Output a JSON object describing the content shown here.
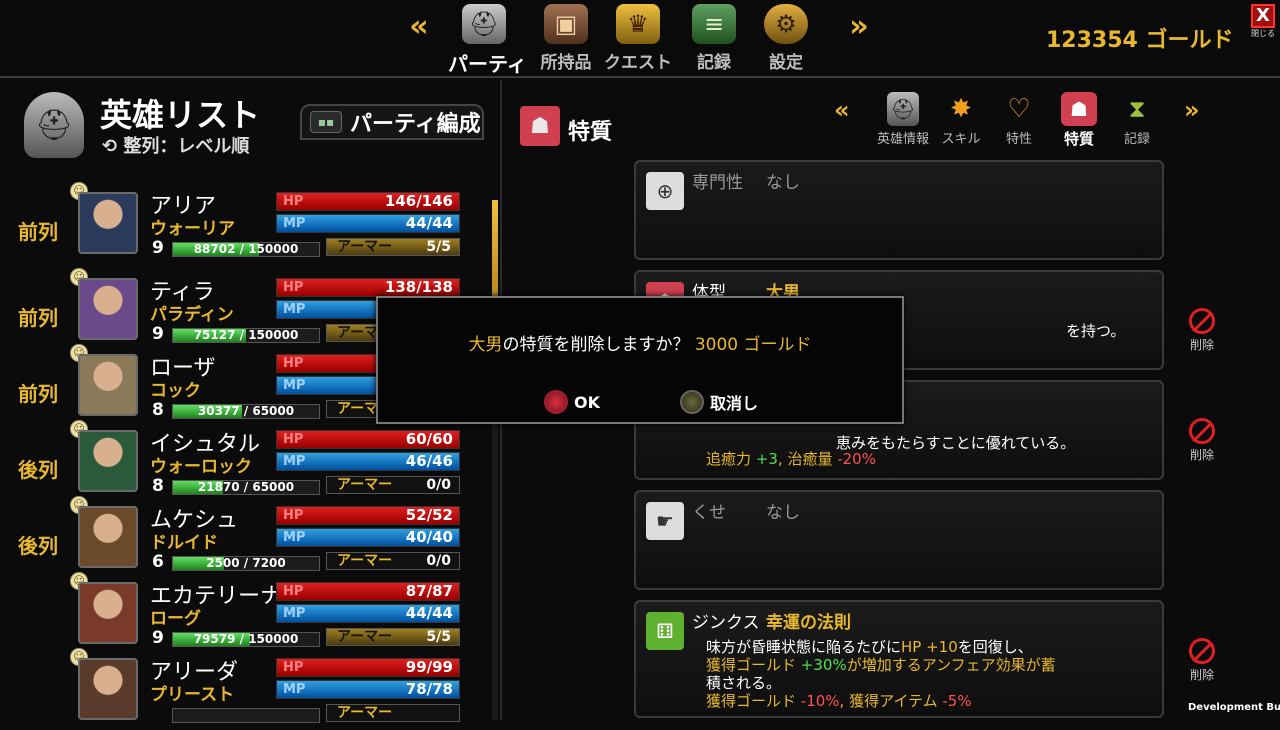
{
  "nav": {
    "tabs": [
      {
        "label": "パーティ",
        "icon": "knight-helmet-icon",
        "active": true
      },
      {
        "label": "所持品",
        "icon": "backpack-icon",
        "active": false
      },
      {
        "label": "クエスト",
        "icon": "trophy-cup-icon",
        "active": false
      },
      {
        "label": "記録",
        "icon": "scroll-icon",
        "active": false
      },
      {
        "label": "設定",
        "icon": "gear-icon",
        "active": false
      }
    ],
    "prev_glyph": "«",
    "next_glyph": "»"
  },
  "gold_display": "123354 ゴールド",
  "close_button": {
    "glyph": "X",
    "label": "閉じる"
  },
  "left": {
    "title": "英雄リスト",
    "sort": "整列：レベル順",
    "sort_glyph": "⟲",
    "party_button": "パーティ編成",
    "heroes": [
      {
        "row": "前列",
        "name": "アリア",
        "class": "ウォーリア",
        "level": "9",
        "hp": "146/146",
        "mp": "44/44",
        "xp": "88702 / 150000",
        "xp_fraction": 0.59,
        "armor": "5/5",
        "armor_full": true,
        "color": "#2a3a5a",
        "initial": "ア"
      },
      {
        "row": "前列",
        "name": "ティラ",
        "class": "パラディン",
        "level": "9",
        "hp": "138/138",
        "mp": "",
        "xp": "75127 / 150000",
        "xp_fraction": 0.5,
        "armor": "",
        "armor_full": true,
        "color": "#6a4a8a",
        "initial": "テ"
      },
      {
        "row": "前列",
        "name": "ローザ",
        "class": "コック",
        "level": "8",
        "hp": "",
        "mp": "",
        "xp": "30377 / 65000",
        "xp_fraction": 0.47,
        "armor": "",
        "armor_full": false,
        "color": "#8a7a5a",
        "initial": "ロ"
      },
      {
        "row": "後列",
        "name": "イシュタル",
        "class": "ウォーロック",
        "level": "8",
        "hp": "60/60",
        "mp": "46/46",
        "xp": "21870 / 65000",
        "xp_fraction": 0.34,
        "armor": "0/0",
        "armor_full": false,
        "color": "#2a5a3a",
        "initial": "イ"
      },
      {
        "row": "後列",
        "name": "ムケシュ",
        "class": "ドルイド",
        "level": "6",
        "hp": "52/52",
        "mp": "40/40",
        "xp": "2500 / 7200",
        "xp_fraction": 0.35,
        "armor": "0/0",
        "armor_full": false,
        "color": "#6a4a2a",
        "initial": "ム"
      },
      {
        "row": "",
        "name": "エカテリーナ",
        "class": "ローグ",
        "level": "9",
        "hp": "87/87",
        "mp": "44/44",
        "xp": "79579 / 150000",
        "xp_fraction": 0.53,
        "armor": "5/5",
        "armor_full": true,
        "color": "#7a3a2a",
        "initial": "エ"
      },
      {
        "row": "",
        "name": "アリーダ",
        "class": "プリースト",
        "level": "",
        "hp": "99/99",
        "mp": "78/78",
        "xp": "",
        "xp_fraction": 0,
        "armor": "",
        "armor_full": false,
        "color": "#5a3a2a",
        "initial": "ア"
      }
    ],
    "hp_label": "HP",
    "mp_label": "MP",
    "armor_label": "アーマー",
    "smiley_glyph": "☺"
  },
  "right": {
    "title": "特質",
    "subtabs": [
      {
        "label": "英雄情報",
        "icon": "helmet-icon",
        "active": false
      },
      {
        "label": "スキル",
        "icon": "burst-icon",
        "active": false
      },
      {
        "label": "特性",
        "icon": "heart-icon",
        "active": false
      },
      {
        "label": "特質",
        "icon": "muscle-body-icon",
        "active": true
      },
      {
        "label": "記録",
        "icon": "hourglass-icon",
        "active": false
      }
    ],
    "cards": [
      {
        "type": "専門性",
        "name": "なし"
      },
      {
        "type": "体型",
        "name": "大男",
        "desc1": "を持つ。"
      },
      {
        "desc1": "恵みをもたらすことに優れている。",
        "desc2_a": "追癒力 ",
        "desc2_b": "+3",
        "desc2_c": ", 治癒量 ",
        "desc2_d": "-20%"
      },
      {
        "type": "くせ",
        "name": "なし"
      },
      {
        "type": "ジンクス",
        "name": "幸運の法則",
        "l1_a": "味方が昏睡状態に陥るたびに",
        "l1_b": "HP +10",
        "l1_c": "を回復し、",
        "l2_a": "獲得ゴールド ",
        "l2_b": "+30%",
        "l2_c": "が増加する",
        "l2_d": "アンフェア",
        "l2_e": "効果が蓄",
        "l3": "積される。",
        "l4_a": "獲得ゴールド ",
        "l4_b": "-10%",
        "l4_c": ", 獲得アイテム ",
        "l4_d": "-5%"
      }
    ],
    "delete_label": "削除"
  },
  "dialog": {
    "trait": "大男",
    "text": "の特質を削除しますか？",
    "cost": "3000 ゴールド",
    "ok": "OK",
    "cancel": "取消し"
  },
  "dev_build": "Development Build"
}
